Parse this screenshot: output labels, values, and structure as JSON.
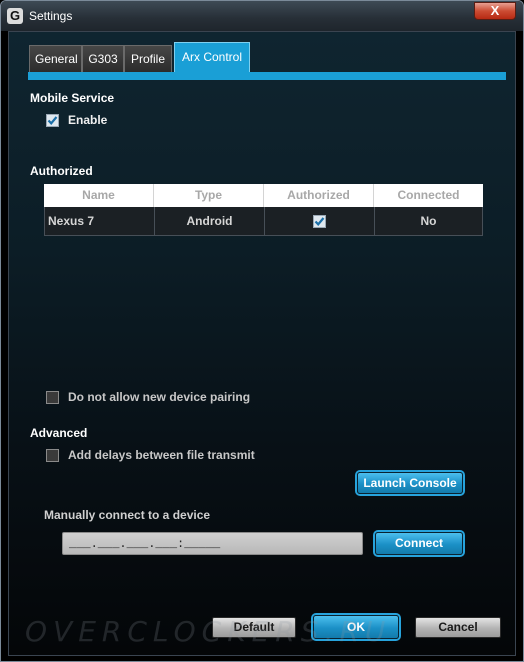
{
  "window": {
    "title": "Settings",
    "app_icon_letter": "G",
    "close_glyph": "X"
  },
  "tabs": [
    {
      "label": "General",
      "active": false
    },
    {
      "label": "G303",
      "active": false
    },
    {
      "label": "Profile",
      "active": false
    },
    {
      "label": "Arx Control",
      "active": true
    }
  ],
  "mobile_service": {
    "heading": "Mobile Service",
    "enable_label": "Enable",
    "enable_checked": true
  },
  "authorized": {
    "heading": "Authorized",
    "columns": [
      "Name",
      "Type",
      "Authorized",
      "Connected"
    ],
    "rows": [
      {
        "name": "Nexus 7",
        "type": "Android",
        "authorized": true,
        "connected": "No"
      }
    ]
  },
  "pairing": {
    "label": "Do not allow new device pairing",
    "checked": false
  },
  "advanced": {
    "heading": "Advanced",
    "delays_label": "Add delays between file transmit",
    "delays_checked": false,
    "launch_console_label": "Launch Console",
    "manual_label": "Manually connect to a device",
    "ip_value": "___.___.___.___:_____",
    "connect_label": "Connect"
  },
  "footer": {
    "default_label": "Default",
    "ok_label": "OK",
    "cancel_label": "Cancel"
  },
  "watermark": "OVERCLOCKERS.RU",
  "colors": {
    "accent": "#1a9fd6",
    "background_top": "#0f2530",
    "background_bottom": "#040608"
  }
}
